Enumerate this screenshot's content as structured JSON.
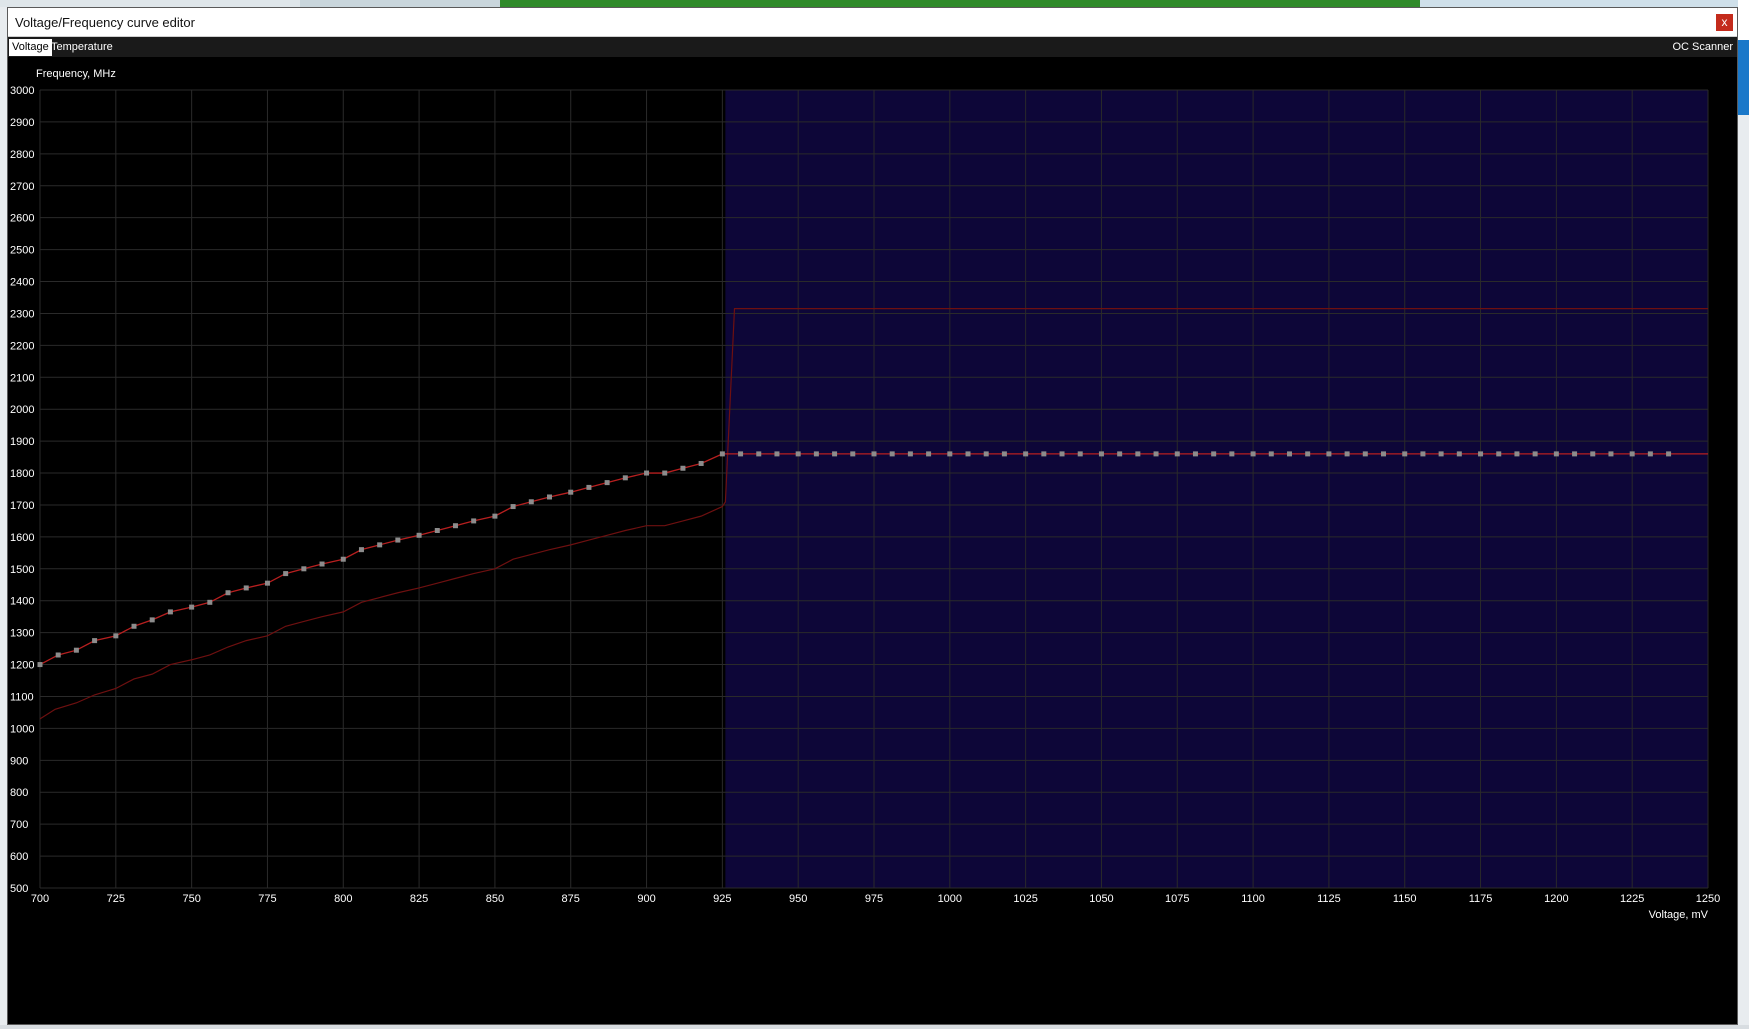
{
  "window": {
    "title": "Voltage/Frequency curve editor",
    "close_label": "x"
  },
  "tabs": {
    "voltage": "Voltage",
    "temperature": "Temperature",
    "oc_scanner": "OC Scanner"
  },
  "colors": {
    "background": "#000000",
    "locked_region": "#0d0638",
    "grid": "#2a2a2a",
    "curve_line": "#b81f1f",
    "reference_line": "#6e1010",
    "point_marker": "#8c8c8c",
    "axis_text": "#ffffff"
  },
  "chart_data": {
    "type": "line",
    "ylabel": "Frequency, MHz",
    "xlabel": "Voltage, mV",
    "xlim": [
      700,
      1250
    ],
    "ylim": [
      500,
      3000
    ],
    "x_ticks": [
      700,
      725,
      750,
      775,
      800,
      825,
      850,
      875,
      900,
      925,
      950,
      975,
      1000,
      1025,
      1050,
      1075,
      1100,
      1125,
      1150,
      1175,
      1200,
      1225,
      1250
    ],
    "y_ticks": [
      500,
      600,
      700,
      800,
      900,
      1000,
      1100,
      1200,
      1300,
      1400,
      1500,
      1600,
      1700,
      1800,
      1900,
      2000,
      2100,
      2200,
      2300,
      2400,
      2500,
      2600,
      2700,
      2800,
      2900,
      3000
    ],
    "grid": true,
    "locked_voltage_from": 926,
    "series": [
      {
        "role": "edited-curve",
        "points": [
          [
            700,
            1200
          ],
          [
            706,
            1230
          ],
          [
            712,
            1245
          ],
          [
            718,
            1275
          ],
          [
            725,
            1290
          ],
          [
            731,
            1320
          ],
          [
            737,
            1340
          ],
          [
            743,
            1365
          ],
          [
            750,
            1380
          ],
          [
            756,
            1395
          ],
          [
            762,
            1425
          ],
          [
            768,
            1440
          ],
          [
            775,
            1455
          ],
          [
            781,
            1485
          ],
          [
            787,
            1500
          ],
          [
            793,
            1515
          ],
          [
            800,
            1530
          ],
          [
            806,
            1560
          ],
          [
            812,
            1575
          ],
          [
            818,
            1590
          ],
          [
            825,
            1605
          ],
          [
            831,
            1620
          ],
          [
            837,
            1635
          ],
          [
            843,
            1650
          ],
          [
            850,
            1665
          ],
          [
            856,
            1695
          ],
          [
            862,
            1710
          ],
          [
            868,
            1725
          ],
          [
            875,
            1740
          ],
          [
            881,
            1755
          ],
          [
            887,
            1770
          ],
          [
            893,
            1785
          ],
          [
            900,
            1800
          ],
          [
            906,
            1800
          ],
          [
            912,
            1815
          ],
          [
            918,
            1830
          ],
          [
            925,
            1860
          ],
          [
            931,
            1860
          ],
          [
            937,
            1860
          ],
          [
            943,
            1860
          ],
          [
            950,
            1860
          ],
          [
            956,
            1860
          ],
          [
            962,
            1860
          ],
          [
            968,
            1860
          ],
          [
            975,
            1860
          ],
          [
            981,
            1860
          ],
          [
            987,
            1860
          ],
          [
            993,
            1860
          ],
          [
            1000,
            1860
          ],
          [
            1006,
            1860
          ],
          [
            1012,
            1860
          ],
          [
            1018,
            1860
          ],
          [
            1025,
            1860
          ],
          [
            1031,
            1860
          ],
          [
            1037,
            1860
          ],
          [
            1043,
            1860
          ],
          [
            1050,
            1860
          ],
          [
            1056,
            1860
          ],
          [
            1062,
            1860
          ],
          [
            1068,
            1860
          ],
          [
            1075,
            1860
          ],
          [
            1081,
            1860
          ],
          [
            1087,
            1860
          ],
          [
            1093,
            1860
          ],
          [
            1100,
            1860
          ],
          [
            1106,
            1860
          ],
          [
            1112,
            1860
          ],
          [
            1118,
            1860
          ],
          [
            1125,
            1860
          ],
          [
            1131,
            1860
          ],
          [
            1137,
            1860
          ],
          [
            1143,
            1860
          ],
          [
            1150,
            1860
          ],
          [
            1156,
            1860
          ],
          [
            1162,
            1860
          ],
          [
            1168,
            1860
          ],
          [
            1175,
            1860
          ],
          [
            1181,
            1860
          ],
          [
            1187,
            1860
          ],
          [
            1193,
            1860
          ],
          [
            1200,
            1860
          ],
          [
            1206,
            1860
          ],
          [
            1212,
            1860
          ],
          [
            1218,
            1860
          ],
          [
            1225,
            1860
          ],
          [
            1231,
            1860
          ],
          [
            1237,
            1860
          ]
        ],
        "line_extends_to": [
          1250,
          1860
        ]
      },
      {
        "role": "default-curve",
        "points": [
          [
            700,
            1030
          ],
          [
            705,
            1060
          ],
          [
            712,
            1080
          ],
          [
            718,
            1105
          ],
          [
            725,
            1125
          ],
          [
            731,
            1155
          ],
          [
            737,
            1170
          ],
          [
            743,
            1200
          ],
          [
            750,
            1215
          ],
          [
            756,
            1230
          ],
          [
            762,
            1255
          ],
          [
            768,
            1275
          ],
          [
            775,
            1290
          ],
          [
            781,
            1320
          ],
          [
            787,
            1335
          ],
          [
            793,
            1350
          ],
          [
            800,
            1365
          ],
          [
            806,
            1395
          ],
          [
            812,
            1410
          ],
          [
            818,
            1425
          ],
          [
            825,
            1440
          ],
          [
            831,
            1455
          ],
          [
            837,
            1470
          ],
          [
            843,
            1485
          ],
          [
            850,
            1500
          ],
          [
            856,
            1530
          ],
          [
            862,
            1545
          ],
          [
            868,
            1560
          ],
          [
            875,
            1575
          ],
          [
            881,
            1590
          ],
          [
            887,
            1605
          ],
          [
            893,
            1620
          ],
          [
            900,
            1635
          ],
          [
            906,
            1635
          ],
          [
            912,
            1650
          ],
          [
            918,
            1665
          ],
          [
            925,
            1695
          ],
          [
            926,
            1710
          ],
          [
            929,
            2315
          ],
          [
            1250,
            2315
          ]
        ]
      }
    ]
  }
}
